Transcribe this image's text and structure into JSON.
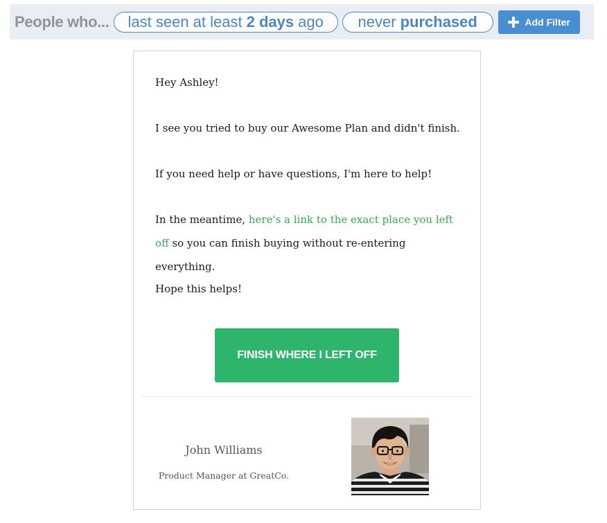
{
  "filter_bar": {
    "lead": "People who...",
    "pills": [
      {
        "prefix": "last seen at least",
        "value": "2 days",
        "suffix": "ago"
      },
      {
        "prefix": "never",
        "value": "purchased"
      }
    ],
    "add_filter_label": "Add Filter",
    "add_filter_icon": "plus-icon",
    "accent_color": "#4a86c5"
  },
  "email": {
    "greeting": "Hey Ashley!",
    "line1": "I see you tried to buy our Awesome Plan and didn't finish.",
    "line2": "If you need help or have questions, I'm here to help!",
    "line3_before": "In the meantime,",
    "line3_link": "here's a link to the exact place you left off",
    "line3_after": "so you can finish buying without re-entering everything.",
    "closing": "Hope this helps!",
    "cta_label": "FINISH WHERE I LEFT OFF",
    "cta_color": "#2fb46c",
    "link_color": "#36a852"
  },
  "signature": {
    "name": "John Williams",
    "title": "Product Manager at GreatCo.",
    "avatar_icon": "person-photo"
  }
}
